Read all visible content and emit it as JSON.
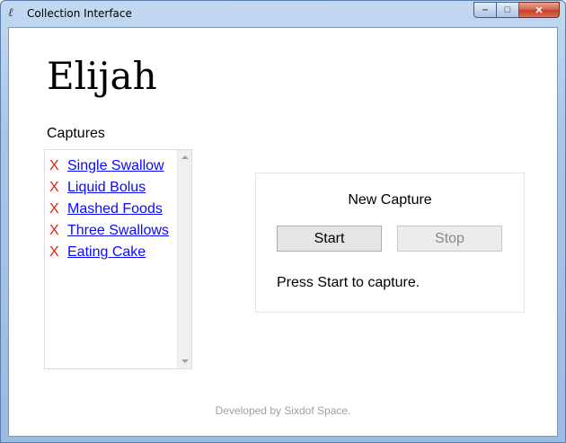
{
  "window": {
    "title": "Collection Interface",
    "minimize_glyph": "–",
    "maximize_glyph": "□",
    "close_glyph": "✕",
    "app_icon_glyph": "ℓ"
  },
  "user": {
    "name": "Elijah"
  },
  "captures": {
    "label": "Captures",
    "delete_glyph": "X",
    "items": [
      {
        "label": "Single Swallow"
      },
      {
        "label": "Liquid Bolus"
      },
      {
        "label": "Mashed Foods"
      },
      {
        "label": "Three Swallows"
      },
      {
        "label": "Eating Cake"
      }
    ]
  },
  "new_capture": {
    "title": "New Capture",
    "start_label": "Start",
    "stop_label": "Stop",
    "status": "Press Start to capture."
  },
  "footer": {
    "text": "Developed by Sixdof Space."
  },
  "colors": {
    "link": "#0a0aff",
    "delete": "#e02020",
    "footer": "#a0a0a0"
  }
}
